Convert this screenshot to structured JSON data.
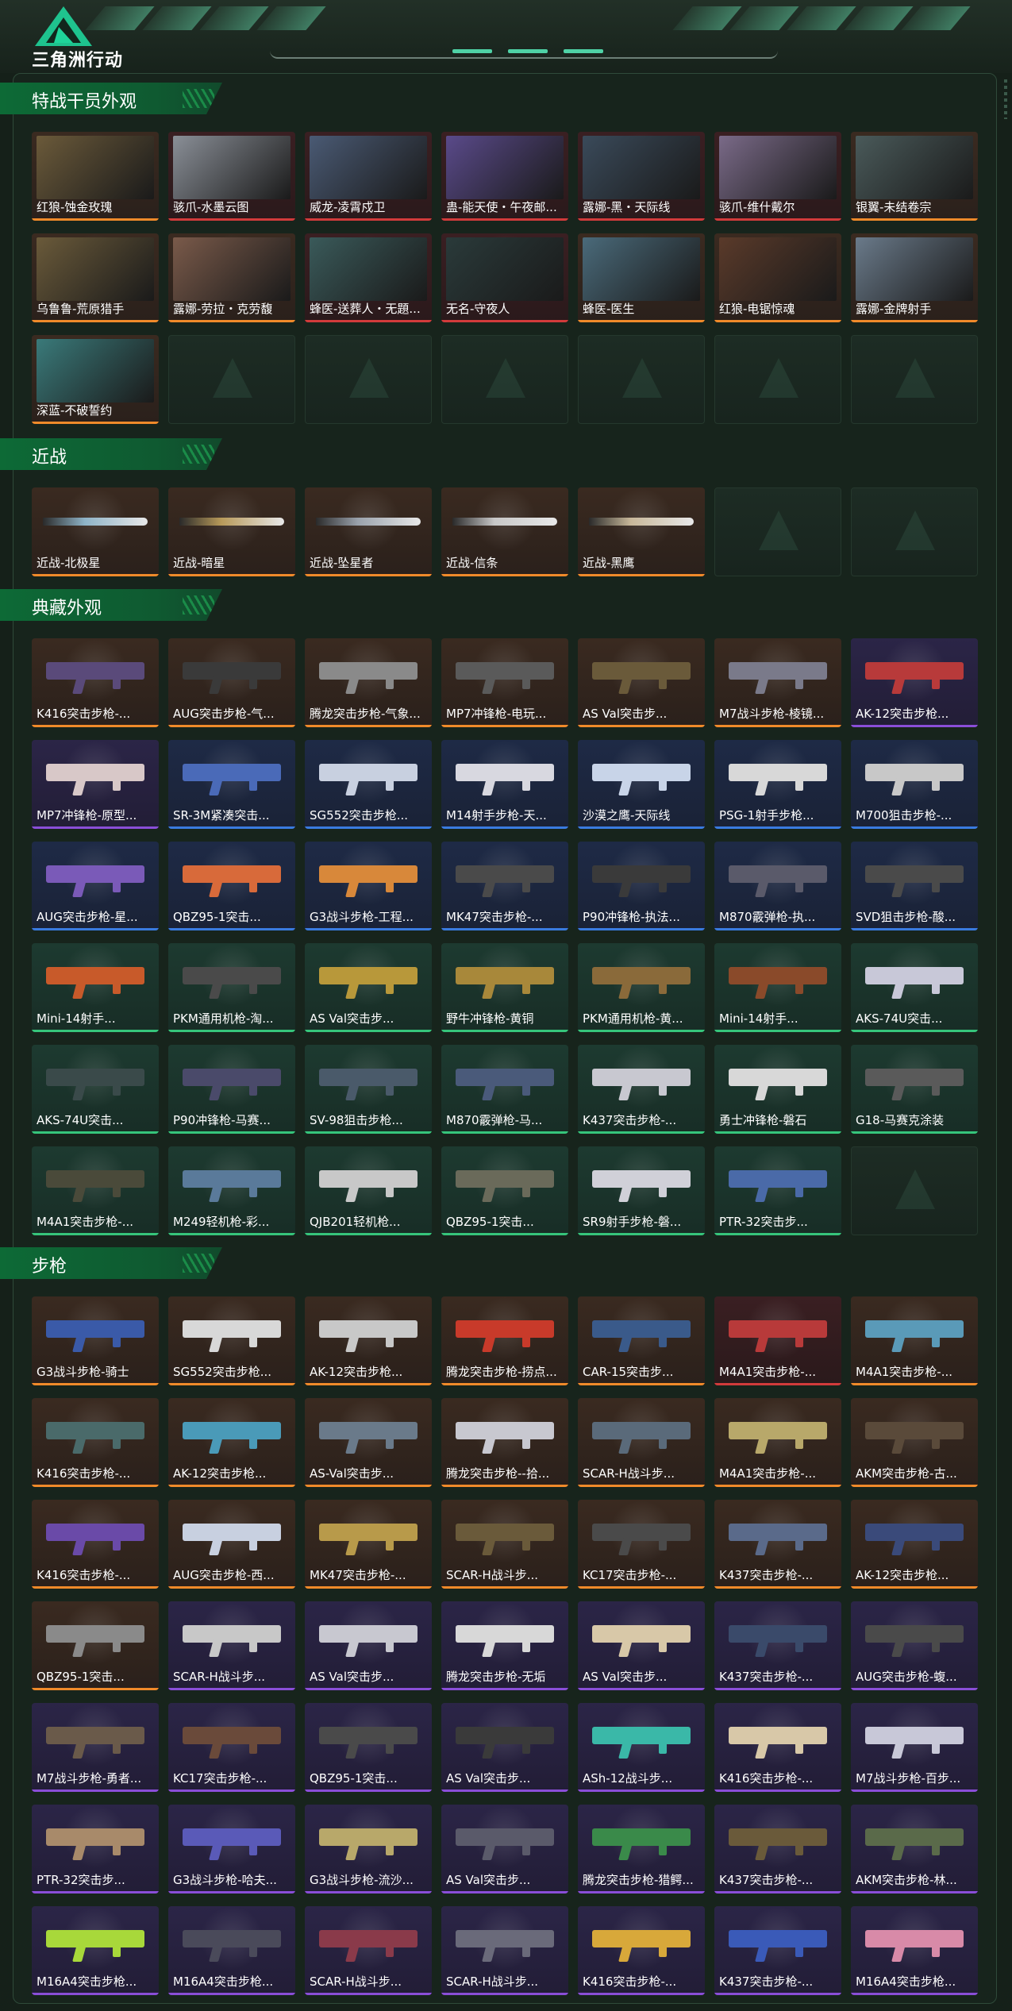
{
  "app": {
    "title": "三角洲行动"
  },
  "colors": {
    "orange": "#f08a2a",
    "red": "#d23b3b",
    "purple": "#8a4ed8",
    "blue": "#3a7be0",
    "green": "#36c57b",
    "accent": "#0d6a36"
  },
  "sections": [
    {
      "title": "特战干员外观",
      "items": [
        {
          "label": "红狼-蚀金玫瑰",
          "rarity": "orange",
          "kind": "portrait",
          "art": "#6b5a3a"
        },
        {
          "label": "骇爪-水墨云图",
          "rarity": "red",
          "kind": "portrait",
          "art": "#8a8f97"
        },
        {
          "label": "威龙-凌霄戍卫",
          "rarity": "red",
          "kind": "portrait",
          "art": "#4a5a74"
        },
        {
          "label": "蛊-能天使・午夜邮...",
          "rarity": "red",
          "kind": "portrait",
          "art": "#5a4a8a"
        },
        {
          "label": "露娜-黑・天际线",
          "rarity": "red",
          "kind": "portrait",
          "art": "#3a4a5a"
        },
        {
          "label": "骇爪-维什戴尔",
          "rarity": "red",
          "kind": "portrait",
          "art": "#7a6a88"
        },
        {
          "label": "银翼-未结卷宗",
          "rarity": "orange",
          "kind": "portrait",
          "art": "#4a5a5a"
        },
        {
          "label": "乌鲁鲁-荒原猎手",
          "rarity": "orange",
          "kind": "portrait",
          "art": "#6a5a3a"
        },
        {
          "label": "露娜-劳拉・克劳馥",
          "rarity": "orange",
          "kind": "portrait",
          "art": "#7a5a4a"
        },
        {
          "label": "蜂医-送葬人・无題...",
          "rarity": "red",
          "kind": "portrait",
          "art": "#3a5a5a"
        },
        {
          "label": "无名-守夜人",
          "rarity": "red",
          "kind": "portrait",
          "art": "#2a3a3a"
        },
        {
          "label": "蜂医-医生",
          "rarity": "orange",
          "kind": "portrait",
          "art": "#4a6a7a"
        },
        {
          "label": "红狼-电锯惊魂",
          "rarity": "orange",
          "kind": "portrait",
          "art": "#5a3a2a"
        },
        {
          "label": "露娜-金牌射手",
          "rarity": "orange",
          "kind": "portrait",
          "art": "#6a7a8a"
        },
        {
          "label": "深蓝-不破誓约",
          "rarity": "orange",
          "kind": "portrait",
          "art": "#3a7a7a"
        },
        {
          "empty": true
        },
        {
          "empty": true
        },
        {
          "empty": true
        },
        {
          "empty": true
        },
        {
          "empty": true
        },
        {
          "empty": true
        }
      ]
    },
    {
      "title": "近战",
      "items": [
        {
          "label": "近战-北极星",
          "rarity": "orange",
          "kind": "knife",
          "art": "#8fb4c8"
        },
        {
          "label": "近战-暗星",
          "rarity": "orange",
          "kind": "knife",
          "art": "#b89a5a"
        },
        {
          "label": "近战-坠星者",
          "rarity": "orange",
          "kind": "knife",
          "art": "#9aa2ac"
        },
        {
          "label": "近战-信条",
          "rarity": "orange",
          "kind": "knife",
          "art": "#c8c8c8"
        },
        {
          "label": "近战-黑鹰",
          "rarity": "orange",
          "kind": "knife",
          "art": "#c8b89a"
        },
        {
          "empty": true
        },
        {
          "empty": true
        }
      ]
    },
    {
      "title": "典藏外观",
      "items": [
        {
          "label": "K416突击步枪-...",
          "rarity": "orange",
          "kind": "gun",
          "art": "#5a4a7a"
        },
        {
          "label": "AUG突击步枪-气...",
          "rarity": "orange",
          "kind": "gun",
          "art": "#3a3a3a"
        },
        {
          "label": "腾龙突击步枪-气象...",
          "rarity": "orange",
          "kind": "gun",
          "art": "#8a8a8a"
        },
        {
          "label": "MP7冲锋枪-电玩...",
          "rarity": "orange",
          "kind": "gun",
          "art": "#5a5a5a"
        },
        {
          "label": "AS Val突击步...",
          "rarity": "orange",
          "kind": "gun",
          "art": "#6a5a3a"
        },
        {
          "label": "M7战斗步枪-棱镜...",
          "rarity": "orange",
          "kind": "gun",
          "art": "#7a7a8a"
        },
        {
          "label": "AK-12突击步枪...",
          "rarity": "purple",
          "kind": "gun",
          "art": "#b83a3a"
        },
        {
          "label": "MP7冲锋枪-原型...",
          "rarity": "purple",
          "kind": "gun",
          "art": "#d8c8c8"
        },
        {
          "label": "SR-3M紧凑突击...",
          "rarity": "blue",
          "kind": "gun",
          "art": "#4a6ab8"
        },
        {
          "label": "SG552突击步枪...",
          "rarity": "blue",
          "kind": "gun",
          "art": "#c8d0e0"
        },
        {
          "label": "M14射手步枪-天...",
          "rarity": "blue",
          "kind": "gun",
          "art": "#d8d8e0"
        },
        {
          "label": "沙漠之鹰-天际线",
          "rarity": "blue",
          "kind": "gun",
          "art": "#c8d4e8"
        },
        {
          "label": "PSG-1射手步枪...",
          "rarity": "blue",
          "kind": "gun",
          "art": "#d8d8d8"
        },
        {
          "label": "M700狙击步枪-...",
          "rarity": "blue",
          "kind": "gun",
          "art": "#c8c8c8"
        },
        {
          "label": "AUG突击步枪-星...",
          "rarity": "blue",
          "kind": "gun",
          "art": "#7a5ab8"
        },
        {
          "label": "QBZ95-1突击...",
          "rarity": "blue",
          "kind": "gun",
          "art": "#d86a3a"
        },
        {
          "label": "G3战斗步枪-工程...",
          "rarity": "blue",
          "kind": "gun",
          "art": "#d8883a"
        },
        {
          "label": "MK47突击步枪-...",
          "rarity": "blue",
          "kind": "gun",
          "art": "#4a4a4a"
        },
        {
          "label": "P90冲锋枪-执法...",
          "rarity": "blue",
          "kind": "gun",
          "art": "#3a3a3a"
        },
        {
          "label": "M870霰弹枪-执...",
          "rarity": "blue",
          "kind": "gun",
          "art": "#5a5a6a"
        },
        {
          "label": "SVD狙击步枪-酸...",
          "rarity": "blue",
          "kind": "gun",
          "art": "#4a4a4a"
        },
        {
          "label": "Mini-14射手...",
          "rarity": "green",
          "kind": "gun",
          "art": "#c85a2a"
        },
        {
          "label": "PKM通用机枪-淘...",
          "rarity": "green",
          "kind": "gun",
          "art": "#4a4a4a"
        },
        {
          "label": "AS Val突击步...",
          "rarity": "green",
          "kind": "gun",
          "art": "#b8983a"
        },
        {
          "label": "野牛冲锋枪-黄铜",
          "rarity": "green",
          "kind": "gun",
          "art": "#a8883a"
        },
        {
          "label": "PKM通用机枪-黄...",
          "rarity": "green",
          "kind": "gun",
          "art": "#8a6a3a"
        },
        {
          "label": "Mini-14射手...",
          "rarity": "green",
          "kind": "gun",
          "art": "#8a4a2a"
        },
        {
          "label": "AKS-74U突击...",
          "rarity": "green",
          "kind": "gun",
          "art": "#c8c8d8"
        },
        {
          "label": "AKS-74U突击...",
          "rarity": "green",
          "kind": "gun",
          "art": "#3a4a4a"
        },
        {
          "label": "P90冲锋枪-马赛...",
          "rarity": "green",
          "kind": "gun",
          "art": "#4a4a6a"
        },
        {
          "label": "SV-98狙击步枪...",
          "rarity": "green",
          "kind": "gun",
          "art": "#4a5a6a"
        },
        {
          "label": "M870霰弹枪-马...",
          "rarity": "green",
          "kind": "gun",
          "art": "#4a5a7a"
        },
        {
          "label": "K437突击步枪-...",
          "rarity": "green",
          "kind": "gun",
          "art": "#c8c8d0"
        },
        {
          "label": "勇士冲锋枪-磐石",
          "rarity": "green",
          "kind": "gun",
          "art": "#d8d8d8"
        },
        {
          "label": "G18-马赛克涂装",
          "rarity": "green",
          "kind": "gun",
          "art": "#5a5a5a"
        },
        {
          "label": "M4A1突击步枪-...",
          "rarity": "green",
          "kind": "gun",
          "art": "#4a4a3a"
        },
        {
          "label": "M249轻机枪-彩...",
          "rarity": "green",
          "kind": "gun",
          "art": "#5a7a9a"
        },
        {
          "label": "QJB201轻机枪...",
          "rarity": "green",
          "kind": "gun",
          "art": "#c8c8c8"
        },
        {
          "label": "QBZ95-1突击...",
          "rarity": "green",
          "kind": "gun",
          "art": "#6a6a5a"
        },
        {
          "label": "SR9射手步枪-磐...",
          "rarity": "green",
          "kind": "gun",
          "art": "#d0d0d8"
        },
        {
          "label": "PTR-32突击步...",
          "rarity": "green",
          "kind": "gun",
          "art": "#4a6aa8"
        },
        {
          "empty": true
        }
      ]
    },
    {
      "title": "步枪",
      "items": [
        {
          "label": "G3战斗步枪-骑士",
          "rarity": "orange",
          "kind": "gun",
          "art": "#3a5aa8"
        },
        {
          "label": "SG552突击步枪...",
          "rarity": "orange",
          "kind": "gun",
          "art": "#d8d8d8"
        },
        {
          "label": "AK-12突击步枪...",
          "rarity": "orange",
          "kind": "gun",
          "art": "#c8c8c8"
        },
        {
          "label": "腾龙突击步枪-捞点...",
          "rarity": "orange",
          "kind": "gun",
          "art": "#c83a2a"
        },
        {
          "label": "CAR-15突击步...",
          "rarity": "orange",
          "kind": "gun",
          "art": "#3a5a8a"
        },
        {
          "label": "M4A1突击步枪-...",
          "rarity": "red",
          "kind": "gun",
          "art": "#b83a3a"
        },
        {
          "label": "M4A1突击步枪-...",
          "rarity": "orange",
          "kind": "gun",
          "art": "#5a9ab8"
        },
        {
          "label": "K416突击步枪-...",
          "rarity": "orange",
          "kind": "gun",
          "art": "#4a6a6a"
        },
        {
          "label": "AK-12突击步枪...",
          "rarity": "orange",
          "kind": "gun",
          "art": "#4a9ab8"
        },
        {
          "label": "AS-Val突击步...",
          "rarity": "orange",
          "kind": "gun",
          "art": "#6a7a8a"
        },
        {
          "label": "腾龙突击步枪--拾...",
          "rarity": "orange",
          "kind": "gun",
          "art": "#c8c8d0"
        },
        {
          "label": "SCAR-H战斗步...",
          "rarity": "orange",
          "kind": "gun",
          "art": "#5a6a7a"
        },
        {
          "label": "M4A1突击步枪-...",
          "rarity": "orange",
          "kind": "gun",
          "art": "#b8a86a"
        },
        {
          "label": "AKM突击步枪-古...",
          "rarity": "orange",
          "kind": "gun",
          "art": "#5a4a3a"
        },
        {
          "label": "K416突击步枪-...",
          "rarity": "orange",
          "kind": "gun",
          "art": "#6a4aa8"
        },
        {
          "label": "AUG突击步枪-西...",
          "rarity": "orange",
          "kind": "gun",
          "art": "#c8d0e0"
        },
        {
          "label": "MK47突击步枪-...",
          "rarity": "orange",
          "kind": "gun",
          "art": "#b89a4a"
        },
        {
          "label": "SCAR-H战斗步...",
          "rarity": "orange",
          "kind": "gun",
          "art": "#6a5a3a"
        },
        {
          "label": "KC17突击步枪-...",
          "rarity": "orange",
          "kind": "gun",
          "art": "#4a4a4a"
        },
        {
          "label": "K437突击步枪-...",
          "rarity": "orange",
          "kind": "gun",
          "art": "#5a6a8a"
        },
        {
          "label": "AK-12突击步枪...",
          "rarity": "orange",
          "kind": "gun",
          "art": "#3a4a7a"
        },
        {
          "label": "QBZ95-1突击...",
          "rarity": "orange",
          "kind": "gun",
          "art": "#8a8a8a"
        },
        {
          "label": "SCAR-H战斗步...",
          "rarity": "purple",
          "kind": "gun",
          "art": "#c8c8c8"
        },
        {
          "label": "AS Val突击步...",
          "rarity": "purple",
          "kind": "gun",
          "art": "#c8c8d0"
        },
        {
          "label": "腾龙突击步枪-无垢",
          "rarity": "purple",
          "kind": "gun",
          "art": "#d8d8d8"
        },
        {
          "label": "AS Val突击步...",
          "rarity": "purple",
          "kind": "gun",
          "art": "#d8c8a8"
        },
        {
          "label": "K437突击步枪-...",
          "rarity": "purple",
          "kind": "gun",
          "art": "#3a4a6a"
        },
        {
          "label": "AUG突击步枪-蝮...",
          "rarity": "purple",
          "kind": "gun",
          "art": "#4a4a4a"
        },
        {
          "label": "M7战斗步枪-勇者...",
          "rarity": "purple",
          "kind": "gun",
          "art": "#6a5a4a"
        },
        {
          "label": "KC17突击步枪-...",
          "rarity": "purple",
          "kind": "gun",
          "art": "#6a4a3a"
        },
        {
          "label": "QBZ95-1突击...",
          "rarity": "purple",
          "kind": "gun",
          "art": "#4a4a4a"
        },
        {
          "label": "AS Val突击步...",
          "rarity": "purple",
          "kind": "gun",
          "art": "#3a3a3a"
        },
        {
          "label": "ASh-12战斗步...",
          "rarity": "purple",
          "kind": "gun",
          "art": "#3ab8a8"
        },
        {
          "label": "K416突击步枪-...",
          "rarity": "purple",
          "kind": "gun",
          "art": "#d8c8a8"
        },
        {
          "label": "M7战斗步枪-百步...",
          "rarity": "purple",
          "kind": "gun",
          "art": "#c8c8d8"
        },
        {
          "label": "PTR-32突击步...",
          "rarity": "purple",
          "kind": "gun",
          "art": "#a88a6a"
        },
        {
          "label": "G3战斗步枪-哈夫...",
          "rarity": "purple",
          "kind": "gun",
          "art": "#5a5ab8"
        },
        {
          "label": "G3战斗步枪-流沙...",
          "rarity": "purple",
          "kind": "gun",
          "art": "#b8a86a"
        },
        {
          "label": "AS Val突击步...",
          "rarity": "purple",
          "kind": "gun",
          "art": "#5a5a6a"
        },
        {
          "label": "腾龙突击步枪-猎鳄...",
          "rarity": "purple",
          "kind": "gun",
          "art": "#3a8a4a"
        },
        {
          "label": "K437突击步枪-...",
          "rarity": "purple",
          "kind": "gun",
          "art": "#6a5a3a"
        },
        {
          "label": "AKM突击步枪-林...",
          "rarity": "purple",
          "kind": "gun",
          "art": "#5a6a4a"
        },
        {
          "label": "M16A4突击步枪...",
          "rarity": "purple",
          "kind": "gun",
          "art": "#a8d83a"
        },
        {
          "label": "M16A4突击步枪...",
          "rarity": "purple",
          "kind": "gun",
          "art": "#4a4a5a"
        },
        {
          "label": "SCAR-H战斗步...",
          "rarity": "purple",
          "kind": "gun",
          "art": "#8a3a4a"
        },
        {
          "label": "SCAR-H战斗步...",
          "rarity": "purple",
          "kind": "gun",
          "art": "#6a6a7a"
        },
        {
          "label": "K416突击步枪-...",
          "rarity": "purple",
          "kind": "gun",
          "art": "#d8a83a"
        },
        {
          "label": "K437突击步枪-...",
          "rarity": "purple",
          "kind": "gun",
          "art": "#3a5ab8"
        },
        {
          "label": "M16A4突击步枪...",
          "rarity": "purple",
          "kind": "gun",
          "art": "#d88aa8"
        }
      ]
    }
  ]
}
